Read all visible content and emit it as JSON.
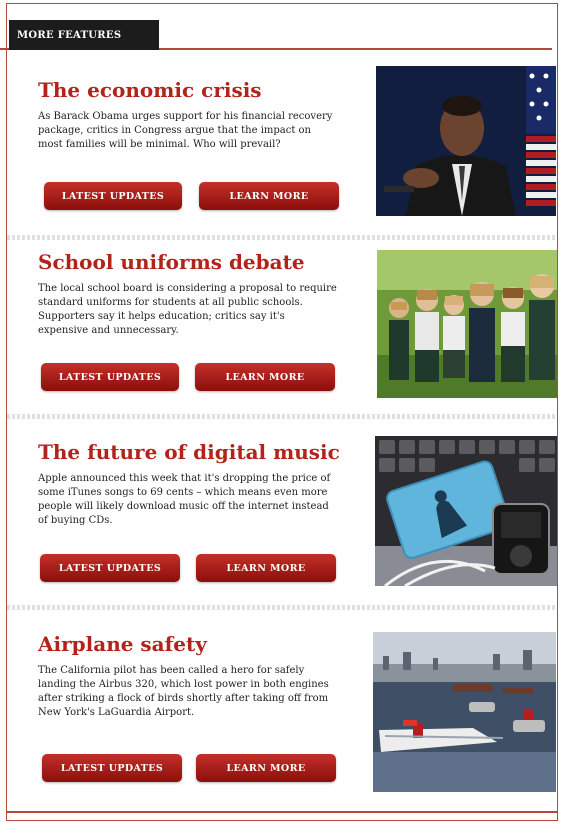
{
  "header": {
    "label": "MORE FEATURES"
  },
  "features": [
    {
      "title": "The economic crisis",
      "text": "As Barack Obama urges support for his financial recovery package, critics in Congress argue that the impact on most families will be minimal. Who will prevail?",
      "latest_label": "LATEST UPDATES",
      "learn_label": "LEARN MORE"
    },
    {
      "title": "School uniforms debate",
      "text": "The local school board is considering a proposal to require standard uniforms for students at all public schools. Supporters say it helps education; critics say it's expensive and unnecessary.",
      "latest_label": "LATEST UPDATES",
      "learn_label": "LEARN MORE"
    },
    {
      "title": "The future of digital music",
      "text": "Apple announced this week that it's dropping the price of some iTunes songs to 69 cents – which means even more people will likely download music off the internet instead of buying CDs.",
      "latest_label": "LATEST UPDATES",
      "learn_label": "LEARN MORE"
    },
    {
      "title": "Airplane safety",
      "text": "The California pilot has been called a hero for safely landing the Airbus 320, which lost power in both engines after striking a flock of birds shortly after taking off from New York's LaGuardia Airport.",
      "latest_label": "LATEST UPDATES",
      "learn_label": "LEARN MORE"
    }
  ],
  "colors": {
    "accent": "#b3231c",
    "button": "#a81c17",
    "header_bg": "#1c1c1c"
  }
}
